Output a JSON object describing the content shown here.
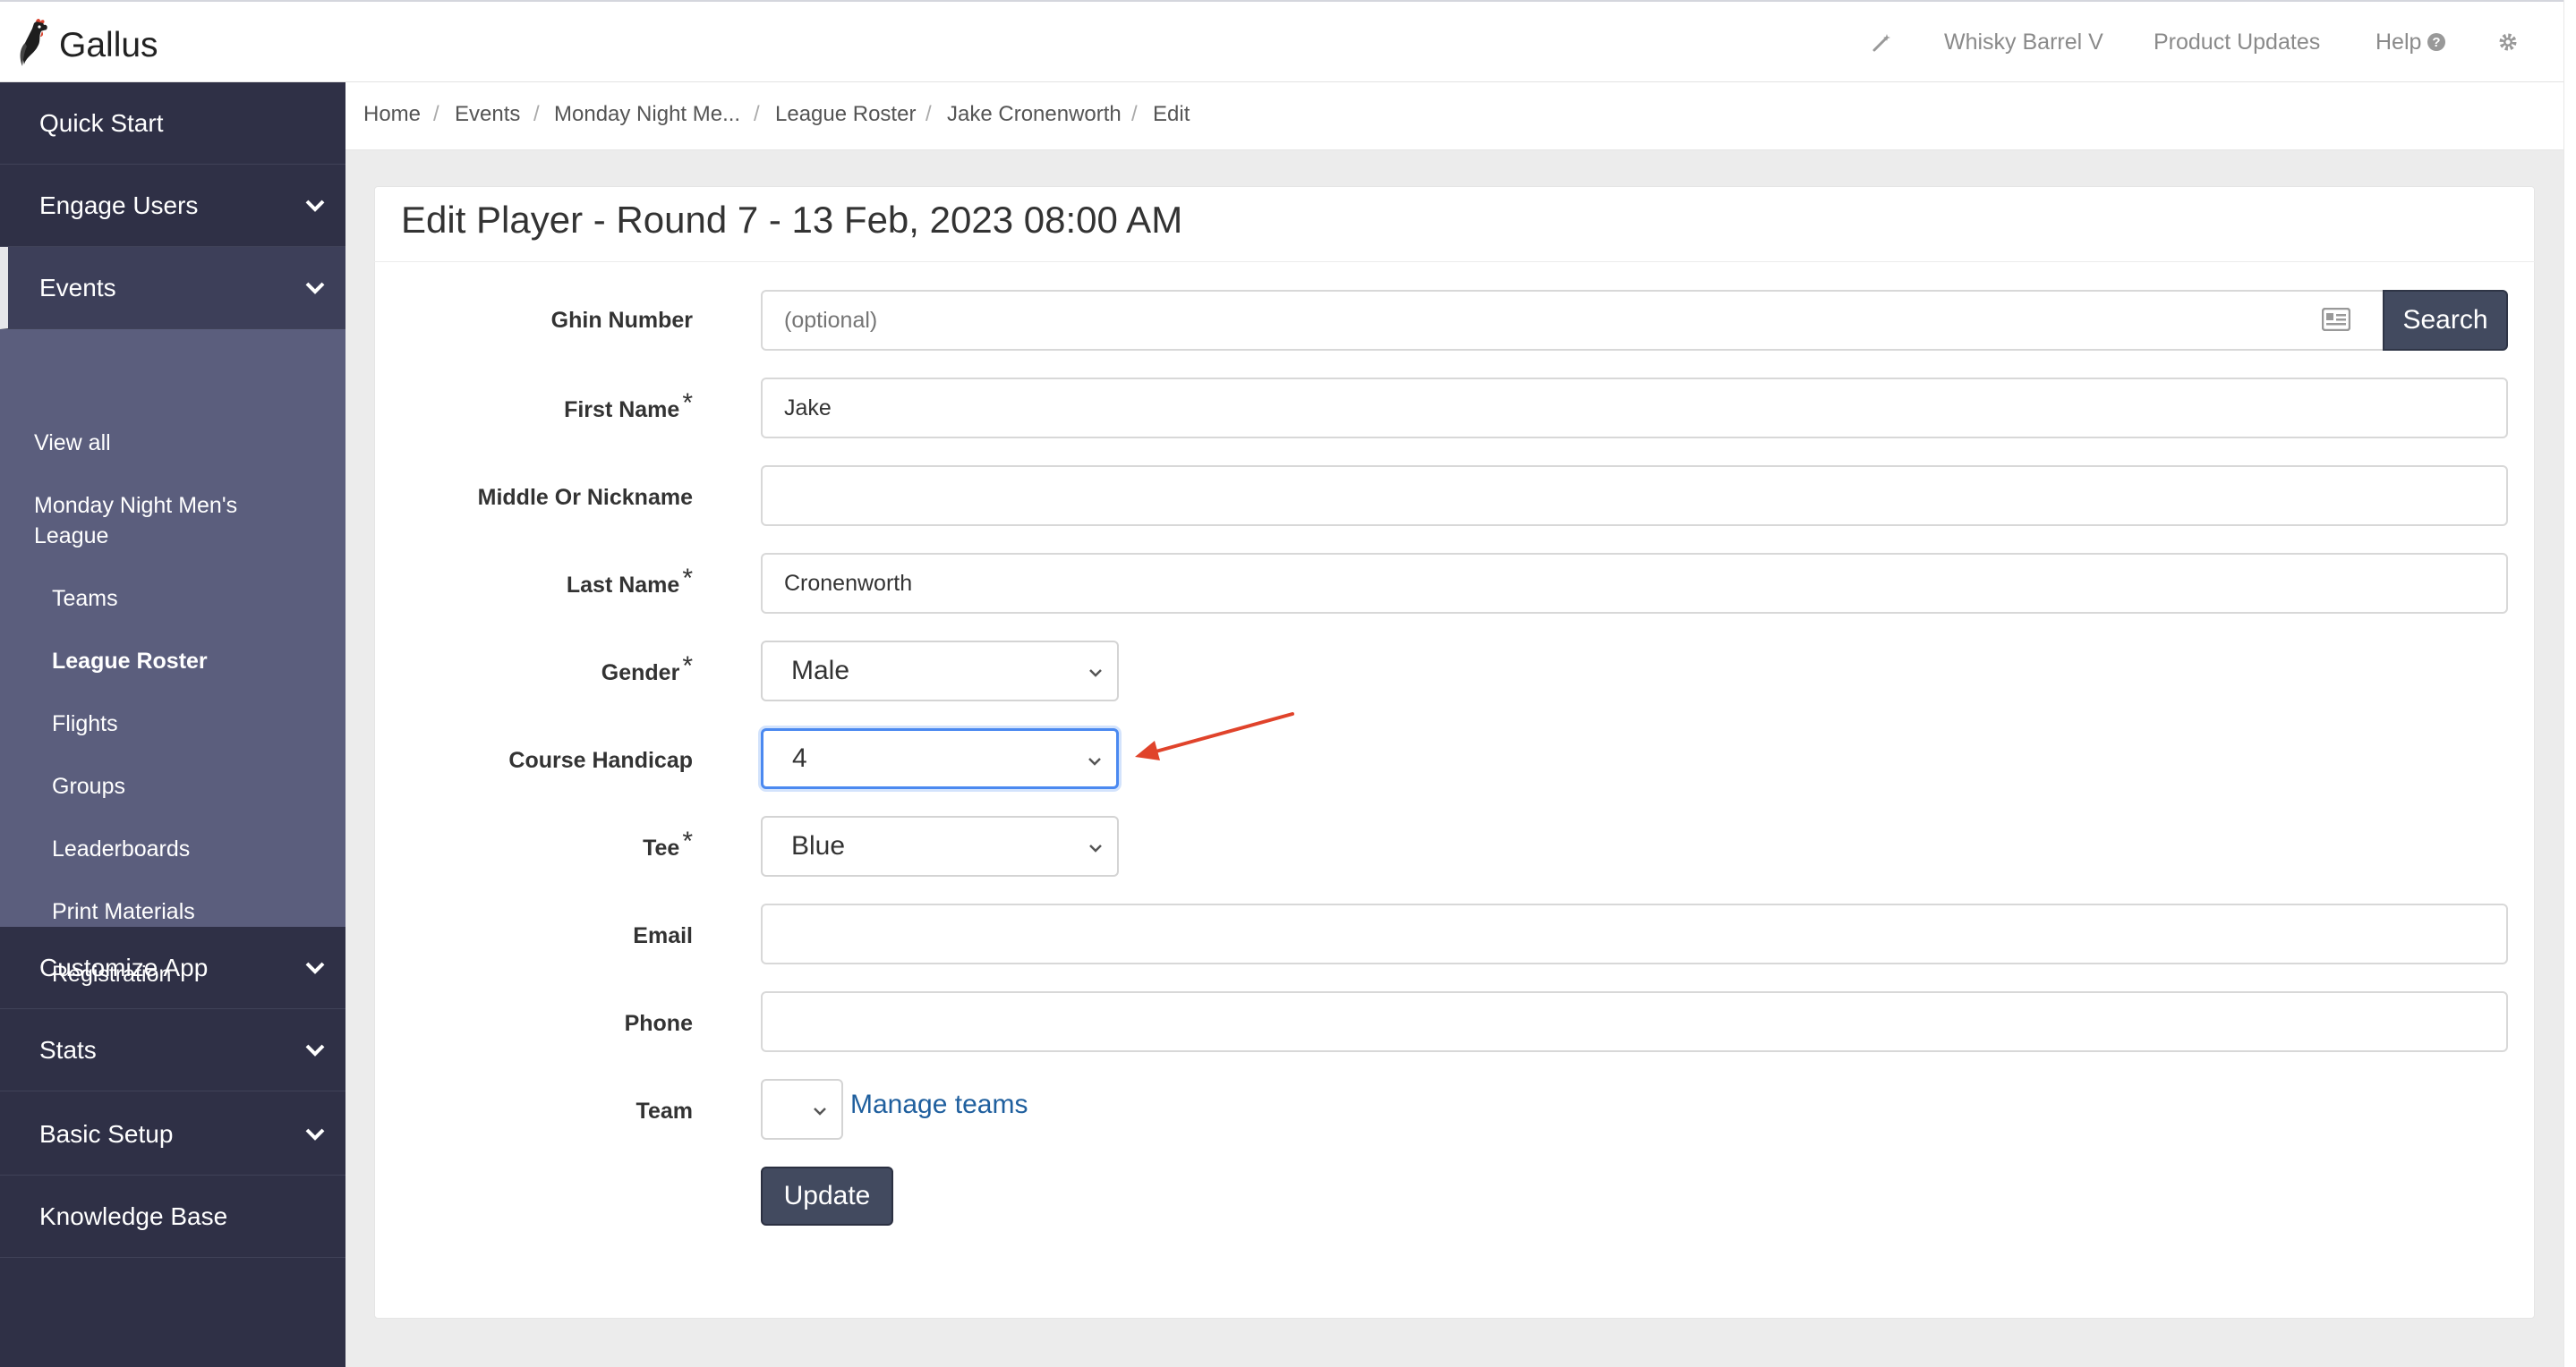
{
  "app": {
    "logo_text": "Gallus"
  },
  "topnav": {
    "magic_icon": "magic-wand-icon",
    "account": "Whisky Barrel V",
    "product_updates": "Product Updates",
    "help": "Help",
    "help_icon": "question-circle-icon",
    "settings_icon": "gear-icon"
  },
  "sidebar": {
    "quick_start": "Quick Start",
    "engage_users": "Engage Users",
    "events": "Events",
    "customize_app": "Customize App",
    "stats": "Stats",
    "basic_setup": "Basic Setup",
    "knowledge_base": "Knowledge Base",
    "events_sub": {
      "view_all": "View all",
      "event_name": "Monday Night Men's League",
      "teams": "Teams",
      "league_roster": "League Roster",
      "flights": "Flights",
      "groups": "Groups",
      "leaderboards": "Leaderboards",
      "print_materials": "Print Materials",
      "registration": "Registration"
    }
  },
  "breadcrumb": {
    "items": [
      "Home",
      "Events",
      "Monday Night Me...",
      "League Roster",
      "Jake Cronenworth",
      "Edit"
    ],
    "separator": "/"
  },
  "form": {
    "title": "Edit Player - Round 7 - 13 Feb, 2023 08:00 AM",
    "required_marker": "*",
    "ghin": {
      "label": "Ghin Number",
      "value": "",
      "placeholder": "(optional)",
      "button": "Search",
      "icon": "id-card-icon"
    },
    "first_name": {
      "label": "First Name",
      "value": "Jake",
      "required": true
    },
    "middle": {
      "label": "Middle Or Nickname",
      "value": ""
    },
    "last_name": {
      "label": "Last Name",
      "value": "Cronenworth",
      "required": true
    },
    "gender": {
      "label": "Gender",
      "value": "Male",
      "required": true
    },
    "course_handicap": {
      "label": "Course Handicap",
      "value": "4"
    },
    "tee": {
      "label": "Tee",
      "value": "Blue",
      "required": true
    },
    "email": {
      "label": "Email",
      "value": ""
    },
    "phone": {
      "label": "Phone",
      "value": ""
    },
    "team": {
      "label": "Team",
      "value": "",
      "link": "Manage teams"
    },
    "update_button": "Update"
  },
  "colors": {
    "sidebar_bg": "#2f3046",
    "submenu_bg": "#5b5e7d",
    "button_bg": "#424a5f",
    "link": "#1f5f9e",
    "focus_border": "#4b89f0",
    "annotation_arrow": "#e0432b"
  }
}
